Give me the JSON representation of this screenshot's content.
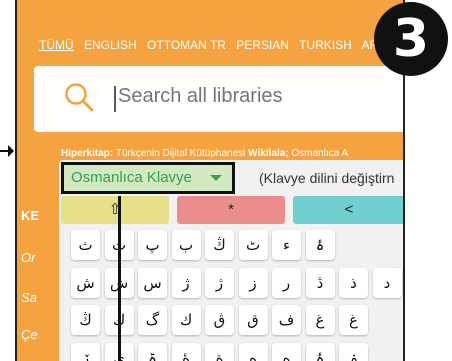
{
  "step_number": "3",
  "tabs": [
    "TÜMÜ",
    "ENGLISH",
    "OTTOMAN TR",
    "PERSIAN",
    "TURKISH",
    "ARA"
  ],
  "search": {
    "placeholder": "Search all libraries"
  },
  "sources": {
    "label1": "Hiperkitap:",
    "text1": "Türkçenin Dijital Kütüphanesi",
    "label2": "Wikilala;",
    "text2": "Osmanlıca A"
  },
  "left_partial_text": [
    "KE",
    "Or",
    "Sa",
    "Çe"
  ],
  "keyboard": {
    "language": "Osmanlıca Klavye",
    "hint": "(Klavye dilini değiştirn",
    "controls": [
      "⇧",
      "*",
      "<"
    ],
    "rows": [
      [
        "ث",
        "ت",
        "پ",
        "ب",
        "ﯓ",
        "ٹ",
        "ء",
        "ۂ"
      ],
      [
        "ش",
        "ش",
        "س",
        "ژ",
        "ژ",
        "ز",
        "ر",
        "ڎ",
        "ذ",
        "د"
      ],
      [
        "ڭ",
        "ك",
        "گ",
        "ك",
        "ڨ",
        "ق",
        "ف",
        "ﻍ",
        "غ"
      ],
      [
        "ڒ",
        "ى",
        "ۃ",
        "ۀ",
        "ة",
        "ه",
        "ه",
        "ۂ",
        "ۏ"
      ]
    ]
  }
}
